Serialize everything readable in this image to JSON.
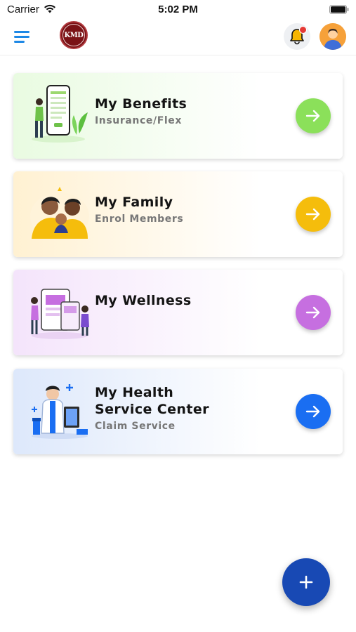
{
  "status_bar": {
    "carrier": "Carrier",
    "time": "5:02 PM"
  },
  "header": {
    "logo_text": "KMD"
  },
  "cards": [
    {
      "title": "My Benefits",
      "subtitle": "Insurance/Flex",
      "accent": "#8be05a",
      "illustration": "phone-benefits-illustration",
      "bg_from": "#e9fbe1",
      "bg_to": "#ffffff"
    },
    {
      "title": "My Family",
      "subtitle": "Enrol Members",
      "accent": "#f5bd0c",
      "illustration": "family-illustration",
      "bg_from": "#fff1d2",
      "bg_to": "#ffffff"
    },
    {
      "title": "My Wellness",
      "subtitle": "",
      "accent": "#c66fe0",
      "illustration": "wellness-illustration",
      "bg_from": "#f4e4fb",
      "bg_to": "#ffffff"
    },
    {
      "title": "My Health\nService Center",
      "subtitle": "Claim Service",
      "accent": "#1a6ef2",
      "illustration": "health-service-illustration",
      "bg_from": "#dde8fb",
      "bg_to": "#ffffff"
    }
  ],
  "fab": {
    "icon": "plus-icon",
    "color": "#1849b4"
  }
}
